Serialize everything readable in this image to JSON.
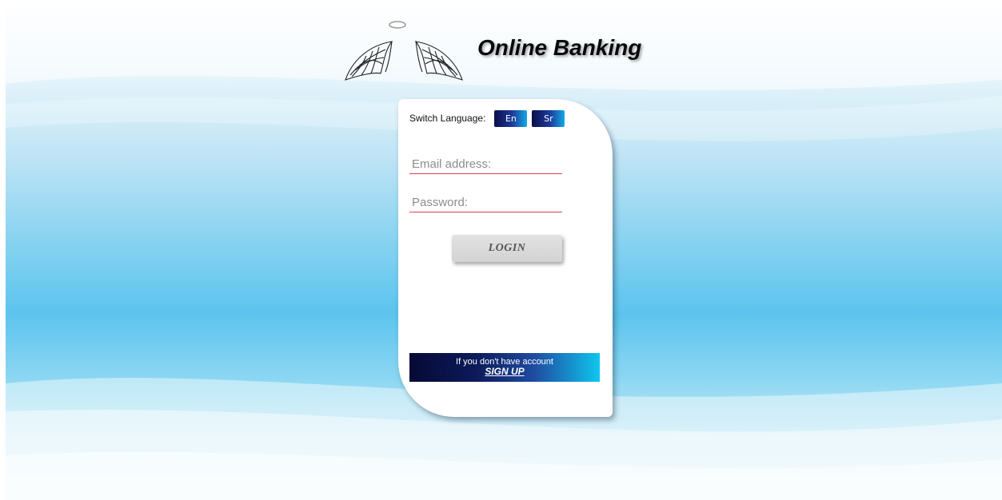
{
  "header": {
    "title": "Online Banking",
    "logo_icon": "angel-wings-halo-icon"
  },
  "language": {
    "label": "Switch Language:",
    "options": [
      "En",
      "Sr"
    ]
  },
  "form": {
    "email_placeholder": "Email address:",
    "password_placeholder": "Password:",
    "login_label": "LOGIN"
  },
  "signup": {
    "prompt": "If you don't have account",
    "link_label": "SIGN UP"
  },
  "colors": {
    "field_underline": "#e04050",
    "button_dark": "#0b0f4a",
    "button_light": "#13a9e6"
  }
}
